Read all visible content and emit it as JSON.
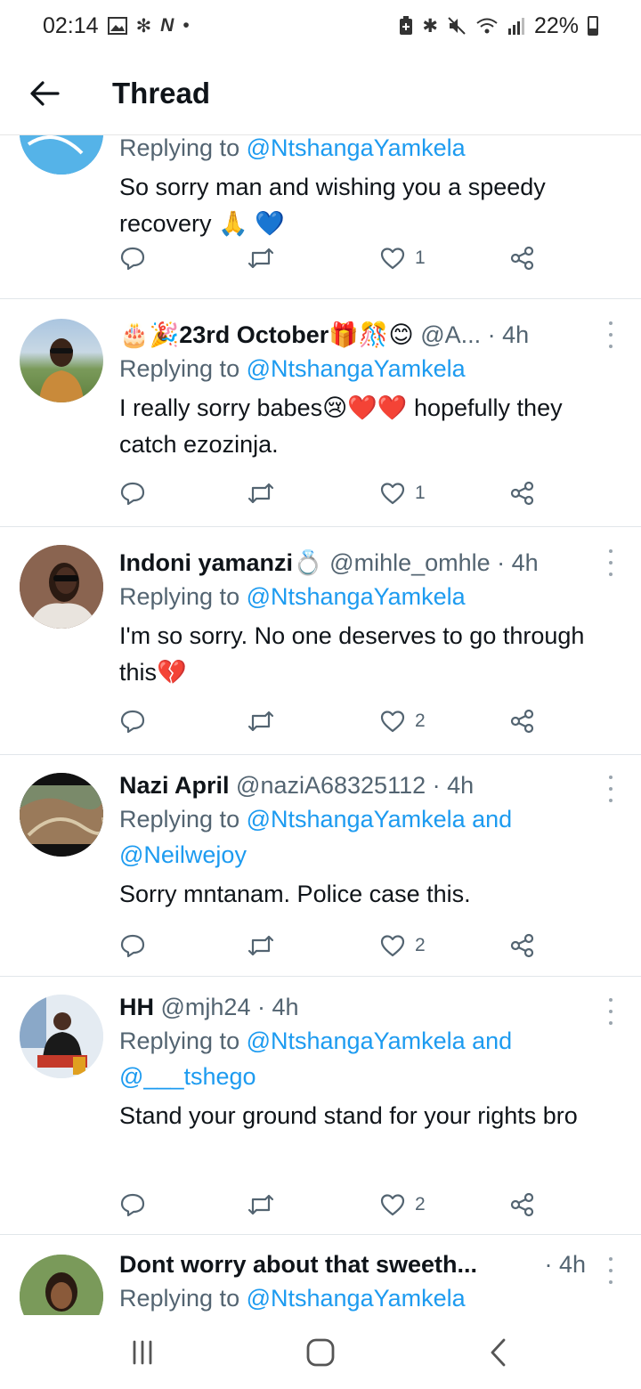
{
  "status_bar": {
    "time": "02:14",
    "battery": "22%",
    "left_icons": [
      "gallery-icon",
      "fan-icon",
      "n-icon",
      "dot-icon"
    ],
    "right_icons": [
      "battery-saver-icon",
      "bluetooth-icon",
      "mute-icon",
      "wifi-icon",
      "signal-icon"
    ]
  },
  "app_bar": {
    "title": "Thread"
  },
  "tweets": [
    {
      "reply_prefix": "Replying to ",
      "reply_to": "@NtshangaYamkela",
      "text": "So sorry man and wishing you a speedy recovery 🙏 💙",
      "likes": "1"
    },
    {
      "name": "🎂🎉23rd October🎁🎊😊",
      "handle": "@A...",
      "time": "· 4h",
      "reply_prefix": "Replying to ",
      "reply_to": "@NtshangaYamkela",
      "text": "I really sorry babes😢❤️❤️ hopefully they catch ezozinja.",
      "likes": "1"
    },
    {
      "name": "Indoni yamanzi💍",
      "handle": "@mihle_omhle",
      "time": "· 4h",
      "reply_prefix": "Replying to ",
      "reply_to": "@NtshangaYamkela",
      "text": "I'm so sorry. No one deserves to go through this💔",
      "likes": "2"
    },
    {
      "name": "Nazi April",
      "handle": "@naziA68325112",
      "time": "· 4h",
      "reply_prefix": "Replying to ",
      "reply_to": "@NtshangaYamkela and @Neilwejoy",
      "text": "Sorry mntanam. Police case this.",
      "likes": "2"
    },
    {
      "name": "HH",
      "handle": "@mjh24",
      "time": "· 4h",
      "reply_prefix": "Replying to ",
      "reply_to": "@NtshangaYamkela and @___tshego",
      "text": "Stand your ground stand for your rights bro",
      "likes": "2"
    },
    {
      "name": "Dont worry about that sweeth...",
      "handle": "",
      "time": "· 4h",
      "reply_prefix": "Replying to ",
      "reply_to": "@NtshangaYamkela"
    }
  ],
  "nav_bar": {
    "buttons": [
      "recent-apps",
      "home",
      "back"
    ]
  }
}
